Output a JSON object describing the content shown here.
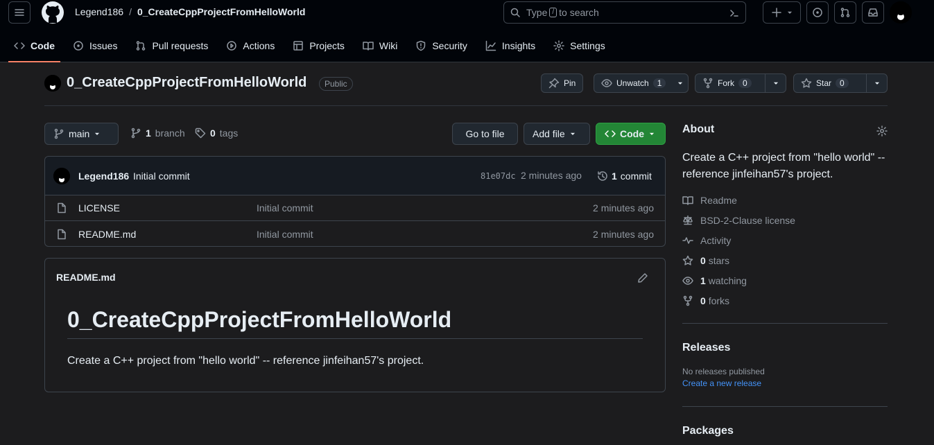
{
  "header": {
    "owner": "Legend186",
    "separator": "/",
    "repo": "0_CreateCppProjectFromHelloWorld",
    "search": {
      "prefix": "Type",
      "key": "/",
      "suffix": "to search"
    }
  },
  "tabs": [
    {
      "label": "Code",
      "icon": "code-icon"
    },
    {
      "label": "Issues",
      "icon": "issue-icon"
    },
    {
      "label": "Pull requests",
      "icon": "pull-request-icon"
    },
    {
      "label": "Actions",
      "icon": "play-icon"
    },
    {
      "label": "Projects",
      "icon": "table-icon"
    },
    {
      "label": "Wiki",
      "icon": "book-icon"
    },
    {
      "label": "Security",
      "icon": "shield-icon"
    },
    {
      "label": "Insights",
      "icon": "graph-icon"
    },
    {
      "label": "Settings",
      "icon": "gear-icon"
    }
  ],
  "repo_header": {
    "name": "0_CreateCppProjectFromHelloWorld",
    "visibility": "Public",
    "pin": "Pin",
    "watch": {
      "label": "Unwatch",
      "count": "1"
    },
    "fork": {
      "label": "Fork",
      "count": "0"
    },
    "star": {
      "label": "Star",
      "count": "0"
    }
  },
  "file_nav": {
    "branch": "main",
    "branch_count": "1",
    "branch_label": "branch",
    "tag_count": "0",
    "tag_label": "tags",
    "go_to_file": "Go to file",
    "add_file": "Add file",
    "code": "Code"
  },
  "latest_commit": {
    "author": "Legend186",
    "message": "Initial commit",
    "sha": "81e07dc",
    "time": "2 minutes ago",
    "commit_count": "1",
    "commit_label": "commit"
  },
  "files": [
    {
      "name": "LICENSE",
      "message": "Initial commit",
      "time": "2 minutes ago"
    },
    {
      "name": "README.md",
      "message": "Initial commit",
      "time": "2 minutes ago"
    }
  ],
  "readme": {
    "filename": "README.md",
    "heading": "0_CreateCppProjectFromHelloWorld",
    "body": "Create a C++ project from \"hello world\" -- reference jinfeihan57's project."
  },
  "about": {
    "title": "About",
    "description": "Create a C++ project from \"hello world\" -- reference jinfeihan57's project.",
    "readme": "Readme",
    "license": "BSD-2-Clause license",
    "activity": "Activity",
    "stars_count": "0",
    "stars_label": "stars",
    "watching_count": "1",
    "watching_label": "watching",
    "forks_count": "0",
    "forks_label": "forks"
  },
  "releases": {
    "title": "Releases",
    "none": "No releases published",
    "create": "Create a new release"
  },
  "packages": {
    "title": "Packages"
  },
  "colors": {
    "accent": "#f78166",
    "primary_button": "#238636",
    "link": "#4493f8",
    "background": "#1c1c1e"
  }
}
